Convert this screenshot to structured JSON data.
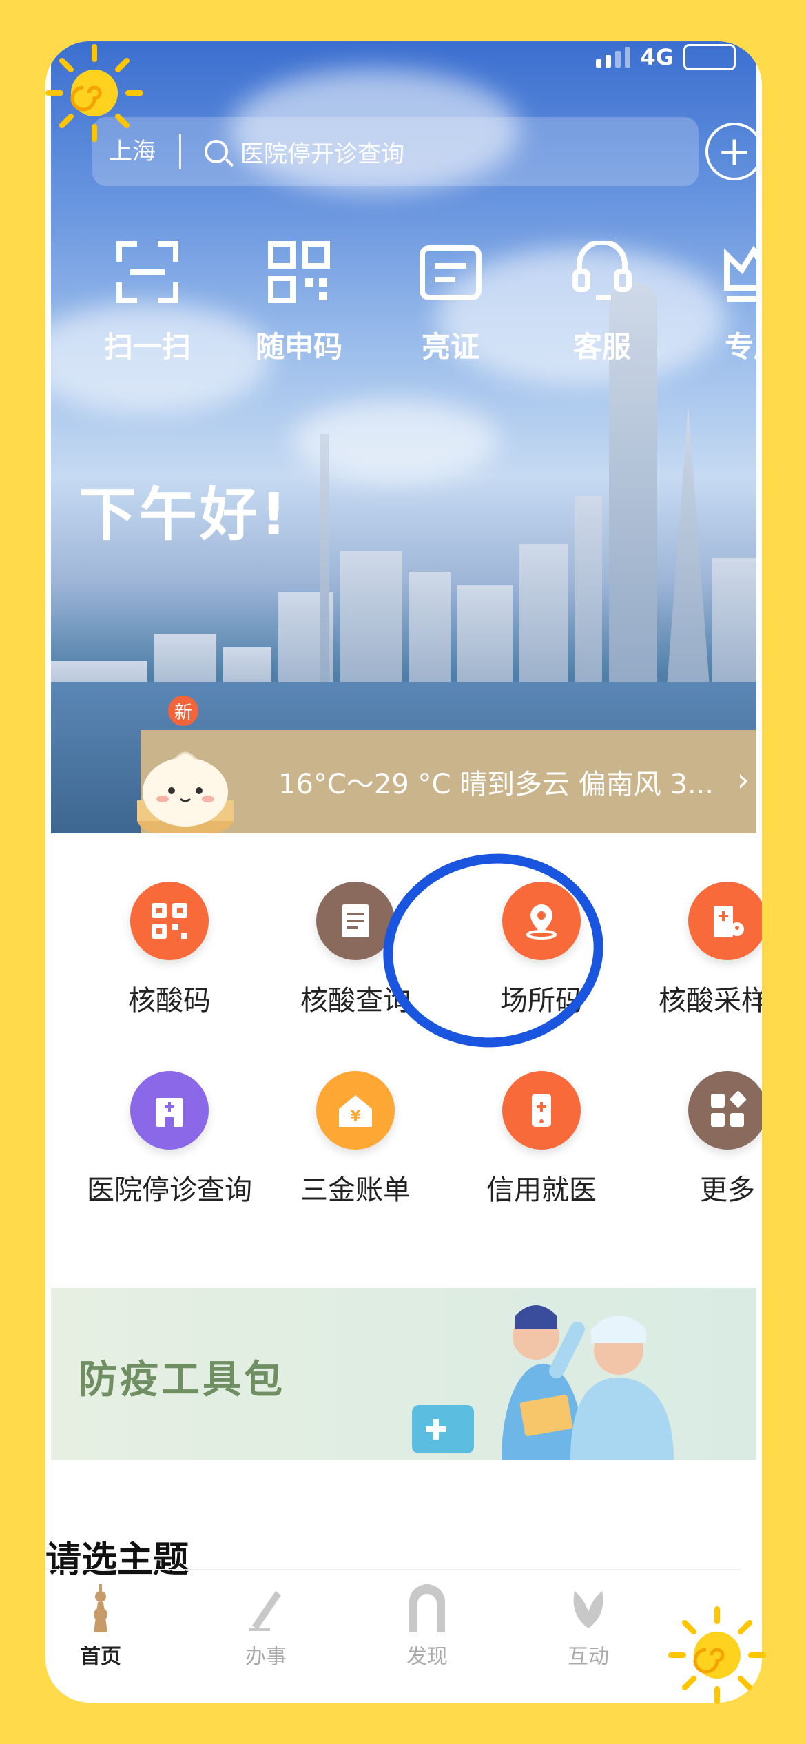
{
  "status_bar": {
    "network": "4G"
  },
  "search": {
    "city": "上海",
    "query": "医院停开诊查询"
  },
  "quick_actions": [
    {
      "label": "扫一扫",
      "icon": "scan-icon"
    },
    {
      "label": "随申码",
      "icon": "qr-code-icon"
    },
    {
      "label": "亮证",
      "icon": "card-icon"
    },
    {
      "label": "客服",
      "icon": "headset-icon"
    },
    {
      "label": "专属",
      "icon": "crown-icon"
    }
  ],
  "greeting": "下午好!",
  "weather": {
    "badge": "新",
    "text": "16°C～29 °C 晴到多云 偏南风 3..."
  },
  "services_row1": [
    {
      "label": "核酸码",
      "icon": "qr-grid-icon",
      "color": "#F86A3A"
    },
    {
      "label": "核酸查询",
      "icon": "document-icon",
      "color": "#8A6A5C"
    },
    {
      "label": "场所码",
      "icon": "location-pin-icon",
      "color": "#F86A3A"
    },
    {
      "label": "核酸采样点",
      "icon": "clinic-icon",
      "color": "#F86A3A"
    }
  ],
  "services_row2": [
    {
      "label": "医院停诊查询",
      "icon": "hospital-icon",
      "color": "#8A68E8"
    },
    {
      "label": "三金账单",
      "icon": "house-yen-icon",
      "color": "#FFA735"
    },
    {
      "label": "信用就医",
      "icon": "phone-plus-icon",
      "color": "#F86A3A"
    },
    {
      "label": "更多",
      "icon": "apps-grid-icon",
      "color": "#8A6A5C"
    }
  ],
  "banner": {
    "title": "防疫工具包"
  },
  "section": {
    "title": "请选主题"
  },
  "tabs": [
    {
      "label": "首页",
      "active": true,
      "icon": "tower-icon"
    },
    {
      "label": "办事",
      "active": false,
      "icon": "pen-icon"
    },
    {
      "label": "发现",
      "active": false,
      "icon": "arch-icon"
    },
    {
      "label": "互动",
      "active": false,
      "icon": "flower-icon"
    }
  ]
}
